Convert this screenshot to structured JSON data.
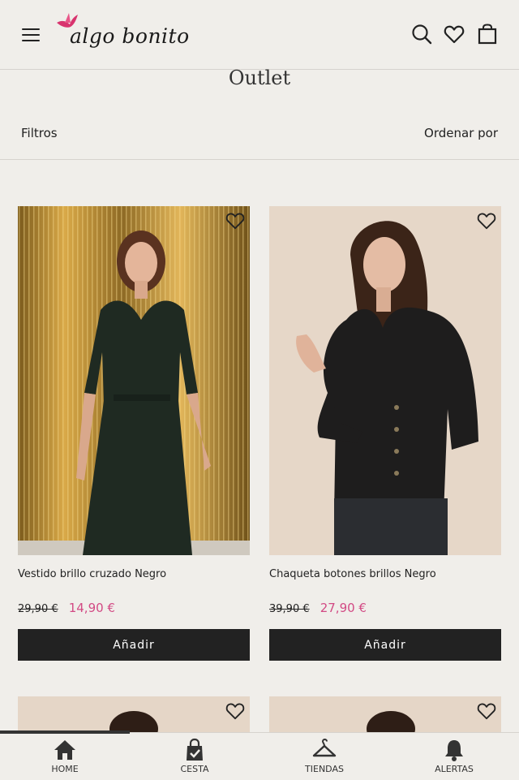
{
  "brand": {
    "logo_text": "algo bonito",
    "bird_color": "#d8346e"
  },
  "header": {
    "menu_icon": "hamburger-icon",
    "search_icon": "search-icon",
    "wishlist_icon": "heart-icon",
    "bag_icon": "shopping-bag-icon"
  },
  "page": {
    "title": "Outlet"
  },
  "toolbar": {
    "filters_label": "Filtros",
    "sort_label": "Ordenar por"
  },
  "products": [
    {
      "name": "Vestido brillo cruzado Negro",
      "old_price": "29,90 €",
      "new_price": "14,90 €",
      "button": "Añadir"
    },
    {
      "name": "Chaqueta botones brillos Negro",
      "old_price": "39,90 €",
      "new_price": "27,90 €",
      "button": "Añadir"
    }
  ],
  "colors": {
    "sale_price": "#d24a84",
    "button_bg": "#222222",
    "page_bg": "#f0eeea"
  },
  "bottom_nav": {
    "items": [
      {
        "label": "HOME",
        "icon": "home-icon"
      },
      {
        "label": "CESTA",
        "icon": "basket-icon"
      },
      {
        "label": "TIENDAS",
        "icon": "hanger-icon"
      },
      {
        "label": "ALERTAS",
        "icon": "bell-icon"
      }
    ]
  }
}
